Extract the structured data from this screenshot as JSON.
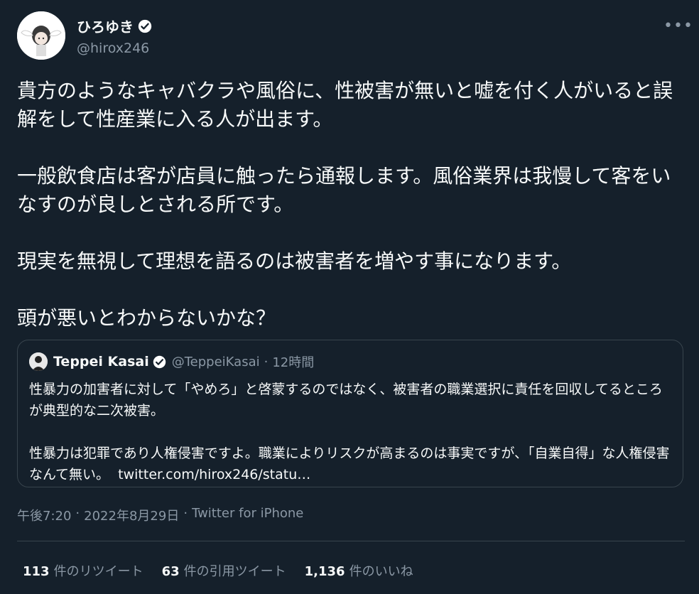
{
  "author": {
    "display_name": "ひろゆき",
    "handle": "@hirox246"
  },
  "tweet": {
    "paragraphs": [
      "貴方のようなキャバクラや風俗に、性被害が無いと嘘を付く人がいると誤解をして性産業に入る人が出ます。",
      "一般飲食店は客が店員に触ったら通報します。風俗業界は我慢して客をいなすのが良しとされる所です。",
      "現実を無視して理想を語るのは被害者を増やす事になります。",
      "頭が悪いとわからないかな？"
    ]
  },
  "quote": {
    "display_name": "Teppei Kasai",
    "handle": "@TeppeiKasai",
    "dot": "·",
    "time": "12時間",
    "paragraph1": "性暴力の加害者に対して「やめろ」と啓蒙するのではなく、被害者の職業選択に責任を回収してるところが典型的な二次被害。",
    "paragraph2": "性暴力は犯罪であり人権侵害ですよ。職業によりリスクが高まるのは事実ですが、「自業自得」な人権侵害なんて無い。",
    "link": "twitter.com/hirox246/statu…"
  },
  "meta": {
    "time": "午後7:20",
    "sep1": "·",
    "date": "2022年8月29日",
    "sep2": "·",
    "source": "Twitter for iPhone"
  },
  "stats": {
    "retweets_count": "113",
    "retweets_label": "件のリツイート",
    "quotes_count": "63",
    "quotes_label": "件の引用ツイート",
    "likes_count": "1,136",
    "likes_label": "件のいいね"
  },
  "colors": {
    "background": "#15202b",
    "text": "#f7f9f9",
    "secondary": "#8b98a5",
    "border": "#38444d",
    "verified": "#ffffff"
  },
  "icons": {
    "verified": "verified-badge-icon",
    "more": "more-horizontal-icon"
  }
}
